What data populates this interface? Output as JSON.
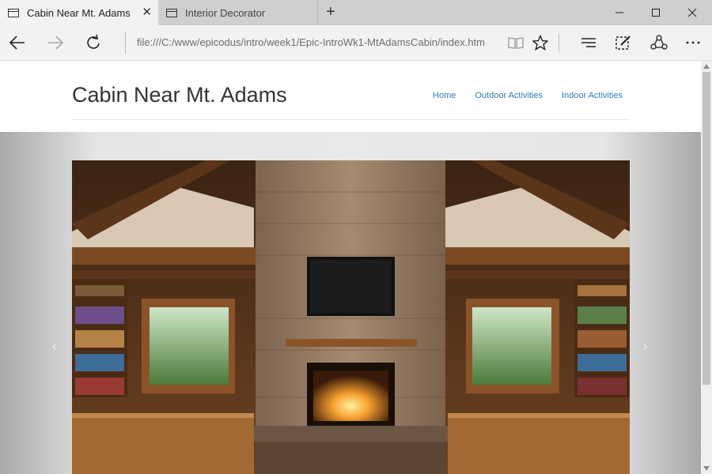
{
  "browser": {
    "tabs": [
      {
        "title": "Cabin Near Mt. Adams",
        "close": "✕"
      },
      {
        "title": "Interior Decorator"
      }
    ],
    "new_tab": "+",
    "address": "file:///C:/www/epicodus/intro/week1/Epic-IntroWk1-MtAdamsCabin/index.htm"
  },
  "site": {
    "brand": "Cabin Near Mt. Adams",
    "nav": [
      "Home",
      "Outdoor Activities",
      "Indoor Activities"
    ],
    "carousel": {
      "prev": "‹",
      "next": "›"
    }
  },
  "icons": {
    "tab": "page-icon",
    "back": "back-arrow-icon",
    "forward": "forward-arrow-icon",
    "refresh": "refresh-icon",
    "reading": "reading-view-icon",
    "favorite": "star-icon",
    "hub": "hub-icon",
    "note": "web-note-icon",
    "share": "share-icon",
    "more": "more-icon",
    "minimize": "minimize-icon",
    "maximize": "maximize-icon",
    "close": "close-icon"
  },
  "colors": {
    "link": "#337ab7",
    "brand_text": "#333333",
    "tabbar": "#cfcfcf",
    "chrome": "#f2f2f2"
  }
}
